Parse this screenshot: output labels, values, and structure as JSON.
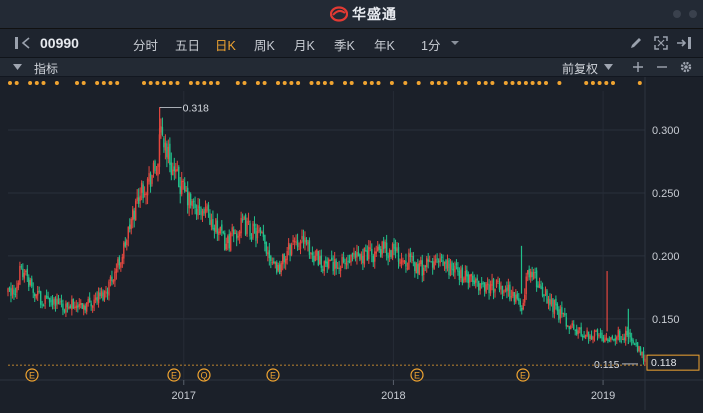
{
  "app": {
    "title": "华盛通"
  },
  "toolbar": {
    "stock_code": "00990",
    "periods": [
      "分时",
      "五日",
      "日K",
      "周K",
      "月K",
      "季K",
      "年K",
      "1分"
    ],
    "active_period": "日K"
  },
  "subbar": {
    "indicator_label": "指标",
    "adjust_label": "前复权"
  },
  "colors": {
    "up": "#e4473f",
    "down": "#21c08b",
    "accent": "#f0a431",
    "background": "#1b2029"
  },
  "chart_data": {
    "type": "candlestick",
    "ylim": [
      0.107,
      0.331
    ],
    "yticks": [
      "0.300",
      "0.250",
      "0.200",
      "0.150"
    ],
    "ytick_values": [
      0.3,
      0.25,
      0.2,
      0.15
    ],
    "xticks": [
      "2017",
      "2018",
      "2019"
    ],
    "high_label": "0.318",
    "high_value": 0.318,
    "low_label": "0.115",
    "low_value": 0.115,
    "last_price": "0.118",
    "last_price_value": 0.118,
    "path_keypoints": [
      [
        "2016-03",
        0.172
      ],
      [
        "2016-03",
        0.19
      ],
      [
        "2016-04",
        0.17
      ],
      [
        "2016-05",
        0.162
      ],
      [
        "2016-06",
        0.16
      ],
      [
        "2016-07",
        0.162
      ],
      [
        "2016-08",
        0.17
      ],
      [
        "2016-09",
        0.2
      ],
      [
        "2016-10",
        0.25
      ],
      [
        "2016-11",
        0.27
      ],
      [
        "2016-11",
        0.3
      ],
      [
        "2016-12",
        0.265
      ],
      [
        "2017-01",
        0.24
      ],
      [
        "2017-02",
        0.23
      ],
      [
        "2017-03",
        0.21
      ],
      [
        "2017-04",
        0.225
      ],
      [
        "2017-05",
        0.215
      ],
      [
        "2017-06",
        0.19
      ],
      [
        "2017-07",
        0.215
      ],
      [
        "2017-08",
        0.2
      ],
      [
        "2017-09",
        0.19
      ],
      [
        "2017-10",
        0.195
      ],
      [
        "2017-11",
        0.2
      ],
      [
        "2017-12",
        0.205
      ],
      [
        "2018-01",
        0.2
      ],
      [
        "2018-02",
        0.19
      ],
      [
        "2018-03",
        0.195
      ],
      [
        "2018-04",
        0.19
      ],
      [
        "2018-05",
        0.18
      ],
      [
        "2018-06",
        0.176
      ],
      [
        "2018-07",
        0.175
      ],
      [
        "2018-08",
        0.16
      ],
      [
        "2018-08",
        0.19
      ],
      [
        "2018-09",
        0.175
      ],
      [
        "2018-10",
        0.155
      ],
      [
        "2018-11",
        0.14
      ],
      [
        "2018-12",
        0.138
      ],
      [
        "2019-01",
        0.136
      ],
      [
        "2019-02",
        0.138
      ],
      [
        "2019-02",
        0.13
      ],
      [
        "2019-03",
        0.118
      ]
    ],
    "dividend_markers": [
      "E",
      "E",
      "Q",
      "E",
      "E",
      "E"
    ]
  }
}
